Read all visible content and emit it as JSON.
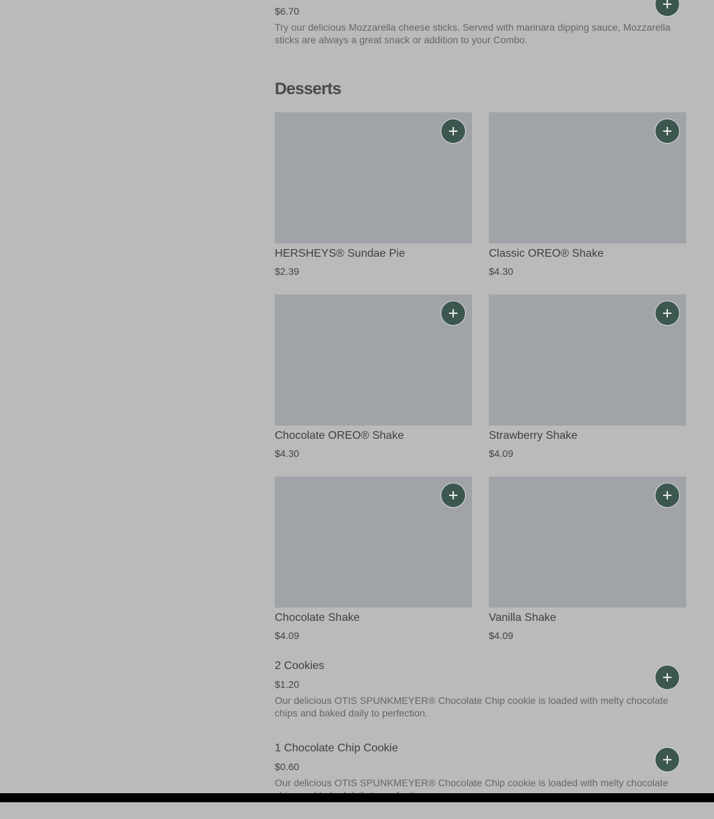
{
  "top_item": {
    "price": "$6.70",
    "description": "Try our delicious Mozzarella cheese sticks. Served with marinara dipping sauce, Mozzarella sticks are always a great snack or addition to your Combo."
  },
  "section": {
    "title": "Desserts"
  },
  "cards": [
    {
      "name": "HERSHEYS® Sundae Pie",
      "price": "$2.39"
    },
    {
      "name": "Classic OREO® Shake",
      "price": "$4.30"
    },
    {
      "name": "Chocolate OREO® Shake",
      "price": "$4.30"
    },
    {
      "name": "Strawberry Shake",
      "price": "$4.09"
    },
    {
      "name": "Chocolate Shake",
      "price": "$4.09"
    },
    {
      "name": "Vanilla Shake",
      "price": "$4.09"
    }
  ],
  "rows": [
    {
      "name": "2 Cookies",
      "price": "$1.20",
      "description": "Our delicious OTIS SPUNKMEYER® Chocolate Chip cookie is loaded with melty chocolate chips and baked daily to perfection."
    },
    {
      "name": "1 Chocolate Chip Cookie",
      "price": "$0.60",
      "description": "Our delicious OTIS SPUNKMEYER® Chocolate Chip cookie is loaded with melty chocolate chips and baked daily to perfection."
    }
  ],
  "icons": {
    "add": "plus-icon"
  },
  "colors": {
    "background": "#bababa",
    "add_button": "#3b5750",
    "image_placeholder": "#a0a3a7"
  }
}
